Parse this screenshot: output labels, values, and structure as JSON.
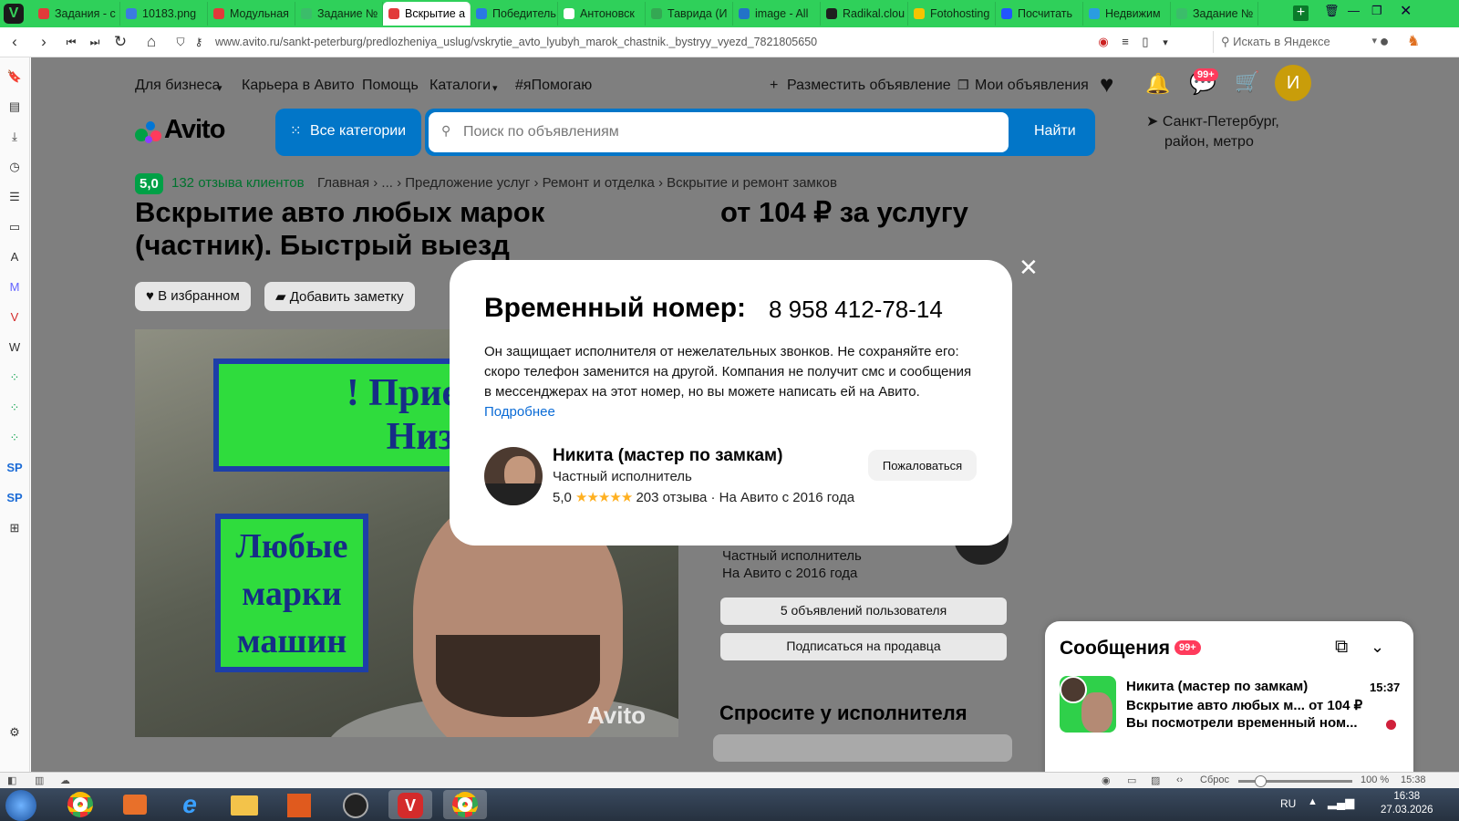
{
  "browser": {
    "tabs": [
      {
        "label": "Задания - с",
        "color": "#e23a3a"
      },
      {
        "label": "10183.png",
        "color": "#3b7be0"
      },
      {
        "label": "Модульная",
        "color": "#e23a3a"
      },
      {
        "label": "Задание №",
        "color": "#3bbd6a"
      },
      {
        "label": "Вскрытие а",
        "color": "#e23a3a",
        "active": true
      },
      {
        "label": "Победитель",
        "color": "#2a78e4"
      },
      {
        "label": "Антоновск",
        "color": "#ffffff"
      },
      {
        "label": "Таврида (И",
        "color": "#34a853"
      },
      {
        "label": "image - All",
        "color": "#2273c7"
      },
      {
        "label": "Radikal.clou",
        "color": "#1f1f1f"
      },
      {
        "label": "Fotohosting",
        "color": "#f5c400"
      },
      {
        "label": "Посчитать",
        "color": "#2255ff"
      },
      {
        "label": "Недвижим",
        "color": "#2a9de0"
      },
      {
        "label": "Задание №",
        "color": "#3bbd6a"
      }
    ],
    "url": "www.avito.ru/sankt-peterburg/predlozheniya_uslug/vskrytie_avto_lyubyh_marok_chastnik._bystryy_vyezd_7821805650",
    "search_placeholder": "Искать в Яндексе"
  },
  "sidebar_icons": [
    "bookmark-icon",
    "reader-icon",
    "download-icon",
    "history-icon",
    "notes-icon",
    "wallet-icon",
    "translate-icon",
    "mastodon-icon",
    "vivaldi-icon",
    "wikipedia-icon",
    "avito-panel-icon",
    "avito-panel-icon",
    "avito-panel-icon",
    "sp-icon",
    "sp-icon",
    "add-panel-icon",
    "settings-icon"
  ],
  "header": {
    "links": [
      "Для бизнеса",
      "Карьера в Авито",
      "Помощь",
      "Каталоги",
      "#яПомогаю"
    ],
    "post_ad": "Разместить объявление",
    "my_ads": "Мои объявления",
    "messages_badge": "99+",
    "user_initial": "И",
    "logo": "Avito",
    "all_categories": "Все категории",
    "search_placeholder": "Поиск по объявлениям",
    "search_button": "Найти",
    "city_line1": "Санкт-Петербург,",
    "city_line2": "район, метро"
  },
  "listing": {
    "rating": "5,0",
    "reviews": "132 отзыва клиентов",
    "breadcrumbs": "Главная › ... › Предложение услуг › Ремонт и отделка › Вскрытие и ремонт замков",
    "title": "Вскрытие авто любых марок (частник). Быстрый выезд",
    "price": "от 104 ₽ за услугу",
    "favorite": "В избранном",
    "add_note": "Добавить заметку",
    "photo_sign1_line1": "! Приеду им",
    "photo_sign1_line2": "Низкие",
    "photo_sign2_line1": "Любые",
    "photo_sign2_line2": "марки",
    "photo_sign2_line3": "машин",
    "watermark": "Avito",
    "seller_role": "Частный исполнитель",
    "seller_since": "На Авито с 2016 года",
    "user_ads": "5 объявлений пользователя",
    "subscribe": "Подписаться на продавца",
    "ask_title": "Спросите у исполнителя"
  },
  "modal": {
    "title": "Временный номер:",
    "phone": "8 958 412-78-14",
    "description": "Он защищает исполнителя от нежелательных звонков. Не сохраняйте его: скоро телефон заменится на другой. Компания не получит смс и сообщения в мессенджерах на этот номер, но вы можете написать ей на Авито.",
    "more_link": "Подробнее",
    "seller_name": "Никита (мастер по замкам)",
    "seller_role": "Частный исполнитель",
    "rating": "5,0",
    "stars": "★★★★★",
    "reviews": "203 отзыва",
    "since": "· На Авито с 2016 года",
    "report": "Пожаловаться"
  },
  "messages": {
    "title": "Сообщения",
    "badge": "99+",
    "name": "Никита (мастер по замкам)",
    "time": "15:37",
    "subject": "Вскрытие авто любых м...",
    "price": "от 104 ₽",
    "preview": "Вы посмотрели временный ном..."
  },
  "statusbar": {
    "reset": "Сброс",
    "zoom": "100 %",
    "time": "15:38"
  },
  "taskbar": {
    "lang": "RU",
    "time": "16:38",
    "date": "27.03.2026"
  },
  "colors": {
    "tabbar": "#2fd05a",
    "avito_blue": "#0276c8",
    "rating_green": "#00a046",
    "link_blue": "#0a6bd6"
  }
}
